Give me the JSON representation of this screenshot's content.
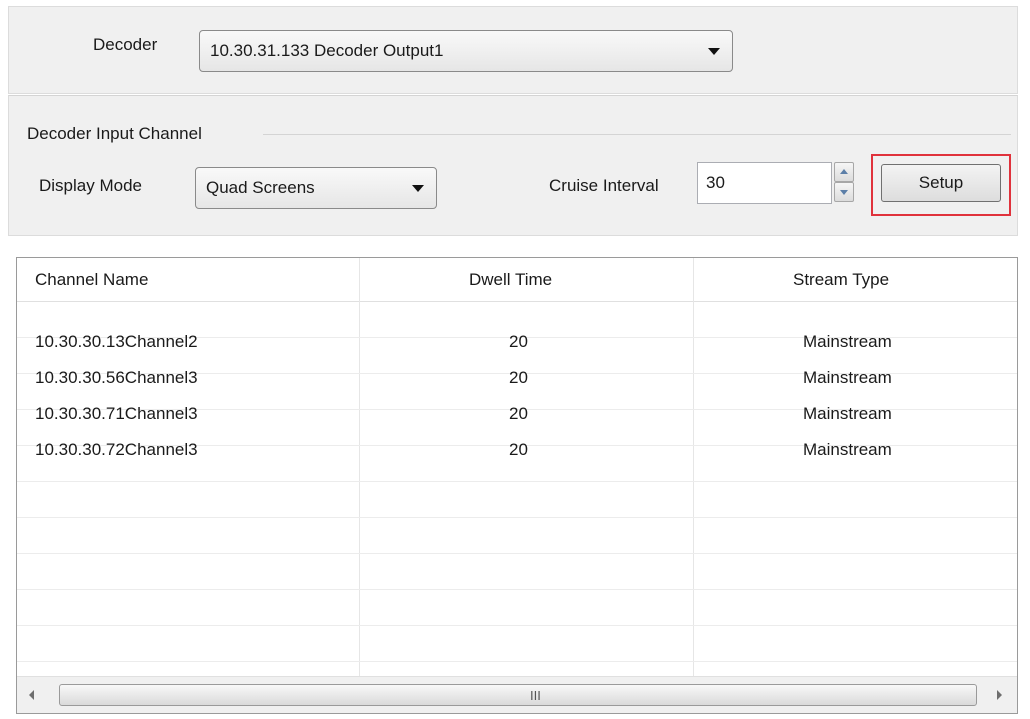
{
  "decoder": {
    "label": "Decoder",
    "selected": "10.30.31.133 Decoder Output1"
  },
  "input_channel": {
    "group_title": "Decoder Input Channel",
    "display_mode_label": "Display Mode",
    "display_mode_value": "Quad Screens",
    "cruise_interval_label": "Cruise Interval",
    "cruise_interval_value": "30",
    "setup_label": "Setup"
  },
  "table": {
    "columns": [
      "Channel Name",
      "Dwell Time",
      "Stream Type"
    ],
    "rows": [
      [
        "10.30.30.13Channel2",
        "20",
        "Mainstream"
      ],
      [
        "10.30.30.56Channel3",
        "20",
        "Mainstream"
      ],
      [
        "10.30.30.71Channel3",
        "20",
        "Mainstream"
      ],
      [
        "10.30.30.72Channel3",
        "20",
        "Mainstream"
      ]
    ],
    "scroll_grip": "III"
  },
  "colors": {
    "highlight_border": "#e0323c",
    "panel_bg": "#f0f0f0"
  },
  "icons": [
    "dropdown-arrow-icon",
    "spinner-up-icon",
    "spinner-down-icon",
    "scroll-left-icon",
    "scroll-right-icon"
  ]
}
